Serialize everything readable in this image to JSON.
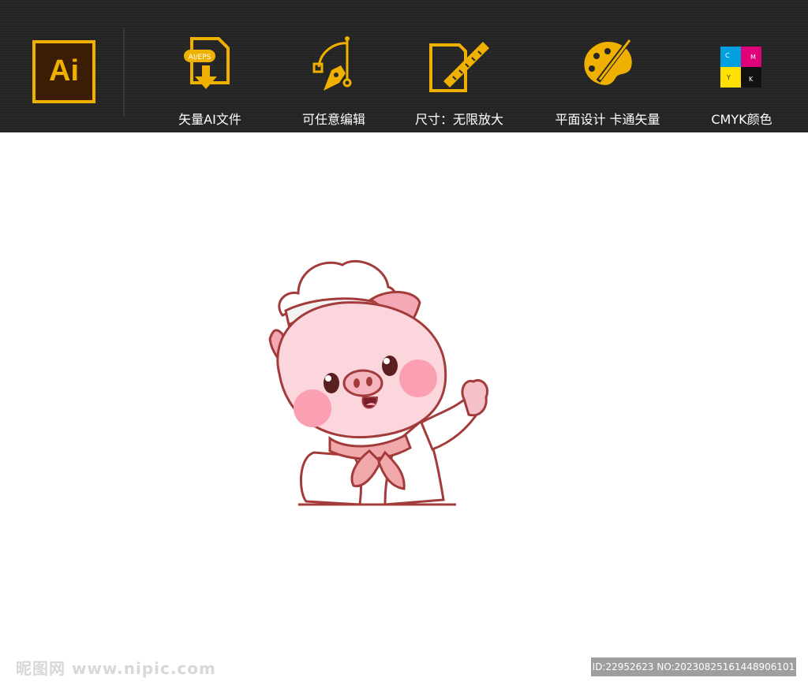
{
  "banner": {
    "logo_text": "Ai",
    "features": [
      {
        "label": "矢量AI文件",
        "icon": "file-download-icon",
        "badge": "AI/EPS"
      },
      {
        "label": "可任意编辑",
        "icon": "pen-tool-icon"
      },
      {
        "label": "尺寸：无限放大",
        "icon": "ruler-document-icon"
      },
      {
        "label": "平面设计  卡通矢量",
        "icon": "palette-icon"
      },
      {
        "label": "CMYK颜色",
        "icon": "cmyk-puzzle-icon",
        "cmyk_letters": [
          "C",
          "M",
          "Y",
          "K"
        ]
      }
    ],
    "accent_color": "#f0b000"
  },
  "illustration": {
    "subject": "chef-pig-cartoon"
  },
  "watermark": {
    "site": "昵图网 www.nipic.com",
    "id_text": "ID:22952623 NO:20230825161448906101"
  }
}
